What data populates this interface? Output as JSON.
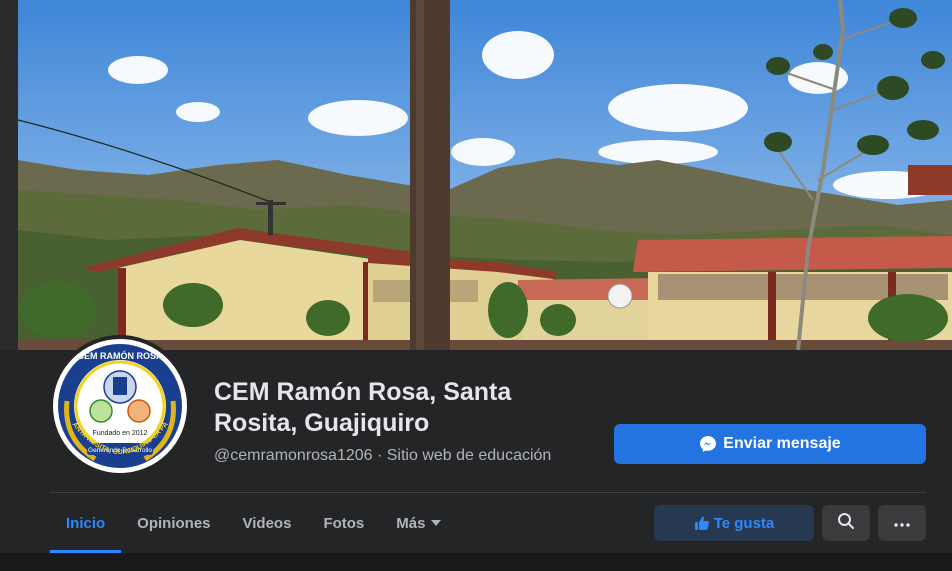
{
  "page": {
    "name": "CEM Ramón Rosa, Santa Rosita, Guajiquiro",
    "subtitle": "@cemramonrosa1206 · Sitio web de educación",
    "avatar_text": {
      "top": "CEM RAMÓN ROSA",
      "side": "SANTA ROSITA, GUAJIQUIRO LA PAZ",
      "middle": "Fundado en 2012",
      "ribbon": "Generando Desarrollo"
    }
  },
  "actions": {
    "message_label": "Enviar mensaje",
    "like_label": "Te gusta"
  },
  "tabs": [
    {
      "label": "Inicio",
      "active": true
    },
    {
      "label": "Opiniones",
      "active": false
    },
    {
      "label": "Videos",
      "active": false
    },
    {
      "label": "Fotos",
      "active": false
    },
    {
      "label": "Más",
      "active": false
    }
  ],
  "icons": {
    "message": "messenger-icon",
    "like": "thumbs-up-icon",
    "search": "search-icon",
    "more": "ellipsis-icon",
    "dropdown": "chevron-down-icon"
  },
  "colors": {
    "background": "#18191a",
    "panel": "#242526",
    "accent": "#2d88ff",
    "button_primary": "#2374e1",
    "button_secondary": "#3a3b3c",
    "like_bg": "#263951"
  }
}
